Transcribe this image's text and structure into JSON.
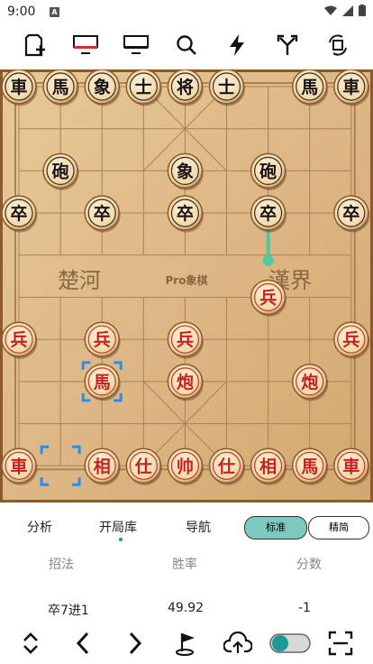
{
  "status": {
    "time": "9:00",
    "notification": "A"
  },
  "toolbar": {
    "icons": [
      "new-game-icon",
      "red-side-icon",
      "black-side-icon",
      "search-icon",
      "lightning-icon",
      "branch-icon",
      "rotate-icon"
    ]
  },
  "board": {
    "river_left": "楚河",
    "river_center": "Pro象棋",
    "river_right": "漢界",
    "pieces": [
      {
        "t": "車",
        "s": "b",
        "c": 0,
        "r": 0
      },
      {
        "t": "馬",
        "s": "b",
        "c": 1,
        "r": 0
      },
      {
        "t": "象",
        "s": "b",
        "c": 2,
        "r": 0
      },
      {
        "t": "士",
        "s": "b",
        "c": 3,
        "r": 0
      },
      {
        "t": "将",
        "s": "b",
        "c": 4,
        "r": 0
      },
      {
        "t": "士",
        "s": "b",
        "c": 5,
        "r": 0
      },
      {
        "t": "馬",
        "s": "b",
        "c": 7,
        "r": 0
      },
      {
        "t": "車",
        "s": "b",
        "c": 8,
        "r": 0
      },
      {
        "t": "砲",
        "s": "b",
        "c": 1,
        "r": 2
      },
      {
        "t": "象",
        "s": "b",
        "c": 4,
        "r": 2
      },
      {
        "t": "砲",
        "s": "b",
        "c": 6,
        "r": 2
      },
      {
        "t": "卒",
        "s": "b",
        "c": 0,
        "r": 3
      },
      {
        "t": "卒",
        "s": "b",
        "c": 2,
        "r": 3
      },
      {
        "t": "卒",
        "s": "b",
        "c": 4,
        "r": 3
      },
      {
        "t": "卒",
        "s": "b",
        "c": 6,
        "r": 3
      },
      {
        "t": "卒",
        "s": "b",
        "c": 8,
        "r": 3
      },
      {
        "t": "兵",
        "s": "r",
        "c": 6,
        "r": 5
      },
      {
        "t": "兵",
        "s": "r",
        "c": 0,
        "r": 6
      },
      {
        "t": "兵",
        "s": "r",
        "c": 2,
        "r": 6
      },
      {
        "t": "兵",
        "s": "r",
        "c": 4,
        "r": 6
      },
      {
        "t": "兵",
        "s": "r",
        "c": 8,
        "r": 6
      },
      {
        "t": "馬",
        "s": "r",
        "c": 2,
        "r": 7,
        "sel": true
      },
      {
        "t": "炮",
        "s": "r",
        "c": 4,
        "r": 7
      },
      {
        "t": "炮",
        "s": "r",
        "c": 7,
        "r": 7
      },
      {
        "t": "車",
        "s": "r",
        "c": 0,
        "r": 9
      },
      {
        "t": "相",
        "s": "r",
        "c": 2,
        "r": 9
      },
      {
        "t": "仕",
        "s": "r",
        "c": 3,
        "r": 9
      },
      {
        "t": "帅",
        "s": "r",
        "c": 4,
        "r": 9
      },
      {
        "t": "仕",
        "s": "r",
        "c": 5,
        "r": 9
      },
      {
        "t": "相",
        "s": "r",
        "c": 6,
        "r": 9
      },
      {
        "t": "馬",
        "s": "r",
        "c": 7,
        "r": 9
      },
      {
        "t": "車",
        "s": "r",
        "c": 8,
        "r": 9
      }
    ],
    "from_square": {
      "c": 1,
      "r": 9
    },
    "arrow": {
      "c1": 6,
      "r1": 3,
      "c2": 6,
      "r2": 4
    }
  },
  "tabs": {
    "analysis": "分析",
    "opening": "开局库",
    "nav": "导航"
  },
  "modes": {
    "standard": "标准",
    "simple": "精简"
  },
  "table": {
    "headers": [
      "招法",
      "胜率",
      "分数"
    ],
    "rows": [
      [
        "卒7进1",
        "49.92",
        "-1"
      ]
    ]
  },
  "bottom": {
    "icons": [
      "expand-icon",
      "prev-icon",
      "next-icon",
      "flag-icon",
      "upload-icon",
      "toggle-switch",
      "scan-icon"
    ]
  }
}
